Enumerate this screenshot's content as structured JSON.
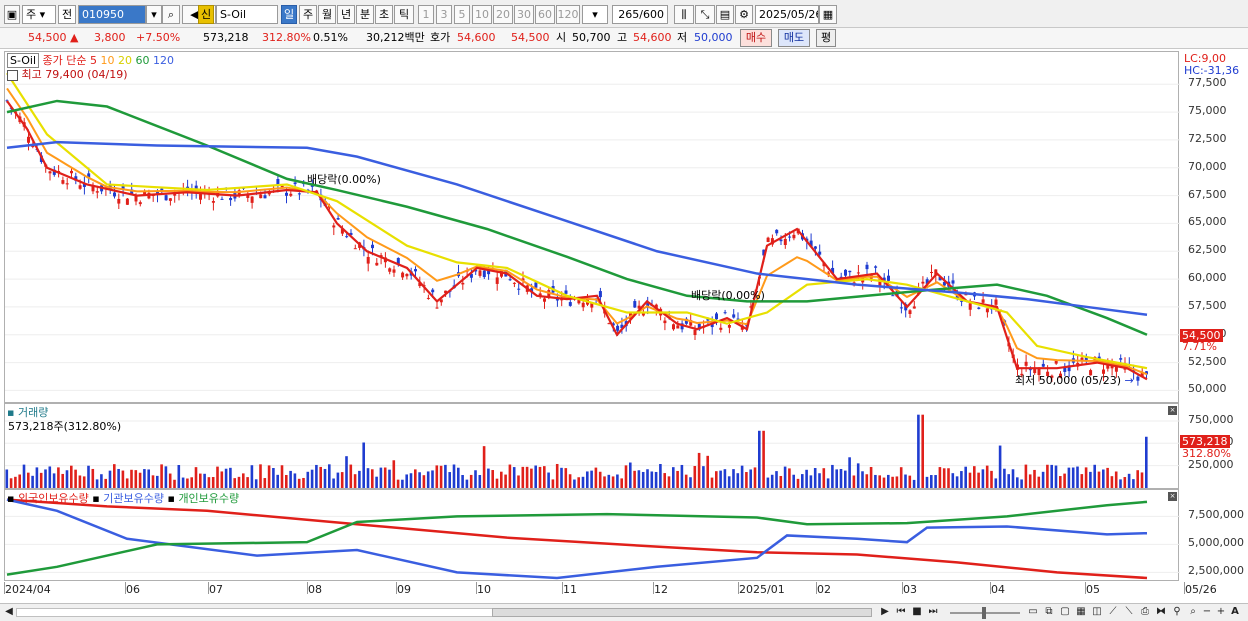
{
  "toolbar": {
    "market": "주",
    "type": "전",
    "code": "010950",
    "new_badge": "신",
    "name": "S-Oil",
    "periods": [
      "일",
      "주",
      "월",
      "년",
      "분",
      "초",
      "틱"
    ],
    "intervals": [
      "1",
      "3",
      "5",
      "10",
      "20",
      "30",
      "60",
      "120"
    ],
    "count": "265/600",
    "date": "2025/05/26"
  },
  "quote": {
    "price": "54,500",
    "change": "3,800",
    "change_pct": "+7.50%",
    "volume": "573,218",
    "vol_ratio": "312.80%",
    "turnover_pct": "0.51%",
    "amount": "30,212백만",
    "ask_label": "호가",
    "ask": "54,600",
    "bid": "54,500",
    "open_label": "시",
    "open": "50,700",
    "high_label": "고",
    "high": "54,600",
    "low_label": "저",
    "low": "50,000",
    "buy_btn": "매수",
    "sell_btn": "매도",
    "eval_btn": "평"
  },
  "price_pane": {
    "symbol": "S-Oil",
    "legend_prefix": "종가 단순",
    "ma": [
      {
        "label": "5",
        "color": "#e0201a"
      },
      {
        "label": "10",
        "color": "#ff9a1a"
      },
      {
        "label": "20",
        "color": "#e8e000"
      },
      {
        "label": "60",
        "color": "#1f9a3a"
      },
      {
        "label": "120",
        "color": "#3a5ee0"
      }
    ],
    "high_note": "최고 79,400 (04/19)",
    "low_note": "최저 50,000 (05/23)",
    "div_note_1": "배당락(0.00%)",
    "div_note_2": "배당락(0.00%)",
    "lc": "LC:9,00",
    "hc": "HC:-31,36",
    "y_ticks": [
      "77,500",
      "75,000",
      "72,500",
      "70,000",
      "67,500",
      "65,000",
      "62,500",
      "60,000",
      "57,500",
      "55,000",
      "52,500",
      "50,000"
    ],
    "last_price": "54,500",
    "last_pct": "7.71%"
  },
  "volume_pane": {
    "title": "거래량",
    "value_note": "573,218주(312.80%)",
    "y_ticks": [
      "750,000",
      "500,000",
      "250,000"
    ],
    "last_vol": "573,218",
    "last_pct": "312.80%"
  },
  "holdings_pane": {
    "legend": [
      {
        "label": "외국인보유수량",
        "color": "#e0201a"
      },
      {
        "label": "기관보유수량",
        "color": "#3a5ee0"
      },
      {
        "label": "개인보유수량",
        "color": "#1f9a3a"
      }
    ],
    "y_ticks": [
      "7,500,000",
      "5,000,000",
      "2,500,000"
    ]
  },
  "x_axis": [
    "2024/04",
    "06",
    "07",
    "08",
    "09",
    "10",
    "11",
    "12",
    "2025/01",
    "02",
    "03",
    "04",
    "05",
    "05/26"
  ],
  "chart_data": {
    "type": "line",
    "title": "S-Oil",
    "price_series": [
      {
        "name": "종가 단순 5",
        "points": [
          [
            0,
            76000
          ],
          [
            20,
            73500
          ],
          [
            40,
            70000
          ],
          [
            80,
            68500
          ],
          [
            130,
            67500
          ],
          [
            180,
            67800
          ],
          [
            230,
            67500
          ],
          [
            280,
            68000
          ],
          [
            310,
            67800
          ],
          [
            330,
            65000
          ],
          [
            360,
            62500
          ],
          [
            400,
            61000
          ],
          [
            430,
            58000
          ],
          [
            470,
            61000
          ],
          [
            500,
            60500
          ],
          [
            530,
            58500
          ],
          [
            560,
            58200
          ],
          [
            590,
            58500
          ],
          [
            610,
            55000
          ],
          [
            640,
            58000
          ],
          [
            670,
            56000
          ],
          [
            690,
            55500
          ],
          [
            720,
            56500
          ],
          [
            740,
            55500
          ],
          [
            760,
            63000
          ],
          [
            790,
            64500
          ],
          [
            830,
            60000
          ],
          [
            870,
            60500
          ],
          [
            900,
            57500
          ],
          [
            930,
            60500
          ],
          [
            960,
            58000
          ],
          [
            990,
            57500
          ],
          [
            1010,
            52000
          ],
          [
            1050,
            52000
          ],
          [
            1090,
            52500
          ],
          [
            1120,
            52000
          ],
          [
            1140,
            51000
          ]
        ]
      },
      {
        "name": "종가 단순 20",
        "points": [
          [
            0,
            78500
          ],
          [
            40,
            73000
          ],
          [
            100,
            68500
          ],
          [
            200,
            68000
          ],
          [
            280,
            68500
          ],
          [
            330,
            67000
          ],
          [
            400,
            63000
          ],
          [
            450,
            61500
          ],
          [
            500,
            61000
          ],
          [
            560,
            58500
          ],
          [
            620,
            57000
          ],
          [
            680,
            57000
          ],
          [
            720,
            56000
          ],
          [
            760,
            57000
          ],
          [
            800,
            59500
          ],
          [
            860,
            60000
          ],
          [
            900,
            59500
          ],
          [
            960,
            58000
          ],
          [
            1000,
            57000
          ],
          [
            1030,
            54000
          ],
          [
            1080,
            53000
          ],
          [
            1140,
            52000
          ]
        ]
      },
      {
        "name": "종가 단순 60",
        "points": [
          [
            0,
            75000
          ],
          [
            50,
            76000
          ],
          [
            100,
            75500
          ],
          [
            200,
            72000
          ],
          [
            280,
            69000
          ],
          [
            330,
            68000
          ],
          [
            400,
            66500
          ],
          [
            480,
            64500
          ],
          [
            560,
            62000
          ],
          [
            620,
            60000
          ],
          [
            680,
            58500
          ],
          [
            740,
            58000
          ],
          [
            800,
            58000
          ],
          [
            860,
            58500
          ],
          [
            920,
            59000
          ],
          [
            990,
            59500
          ],
          [
            1040,
            58500
          ],
          [
            1100,
            56500
          ],
          [
            1140,
            55000
          ]
        ]
      },
      {
        "name": "종가 단순 120",
        "points": [
          [
            0,
            71800
          ],
          [
            50,
            72300
          ],
          [
            150,
            72000
          ],
          [
            300,
            71800
          ],
          [
            350,
            71000
          ],
          [
            450,
            68500
          ],
          [
            550,
            65500
          ],
          [
            650,
            62500
          ],
          [
            750,
            60500
          ],
          [
            850,
            59500
          ],
          [
            950,
            58800
          ],
          [
            1020,
            58200
          ],
          [
            1080,
            57500
          ],
          [
            1140,
            56800
          ]
        ]
      }
    ],
    "holdings_series": [
      {
        "name": "외국인보유수량",
        "points": [
          [
            0,
            9000000
          ],
          [
            100,
            8400000
          ],
          [
            200,
            8000000
          ],
          [
            350,
            6800000
          ],
          [
            500,
            5600000
          ],
          [
            650,
            4800000
          ],
          [
            750,
            4300000
          ],
          [
            850,
            4100000
          ],
          [
            950,
            3400000
          ],
          [
            1050,
            2500000
          ],
          [
            1140,
            2000000
          ]
        ]
      },
      {
        "name": "기관보유수량",
        "points": [
          [
            0,
            9000000
          ],
          [
            50,
            8000000
          ],
          [
            120,
            5500000
          ],
          [
            250,
            4000000
          ],
          [
            350,
            4500000
          ],
          [
            450,
            2500000
          ],
          [
            550,
            2000000
          ],
          [
            650,
            3000000
          ],
          [
            750,
            3800000
          ],
          [
            780,
            5800000
          ],
          [
            850,
            5500000
          ],
          [
            900,
            5200000
          ],
          [
            920,
            6500000
          ],
          [
            1000,
            6600000
          ],
          [
            1100,
            5900000
          ],
          [
            1140,
            6000000
          ]
        ]
      },
      {
        "name": "개인보유수량",
        "points": [
          [
            0,
            2300000
          ],
          [
            50,
            3000000
          ],
          [
            150,
            5000000
          ],
          [
            300,
            5200000
          ],
          [
            350,
            7000000
          ],
          [
            450,
            7500000
          ],
          [
            600,
            7700000
          ],
          [
            750,
            7400000
          ],
          [
            800,
            6800000
          ],
          [
            900,
            6900000
          ],
          [
            1000,
            7500000
          ],
          [
            1100,
            8500000
          ],
          [
            1140,
            8800000
          ]
        ]
      }
    ],
    "ylim_price": [
      49500,
      79500
    ],
    "ylim_holdings": [
      2000000,
      9500000
    ],
    "ylim_volume": [
      0,
      850000
    ]
  }
}
